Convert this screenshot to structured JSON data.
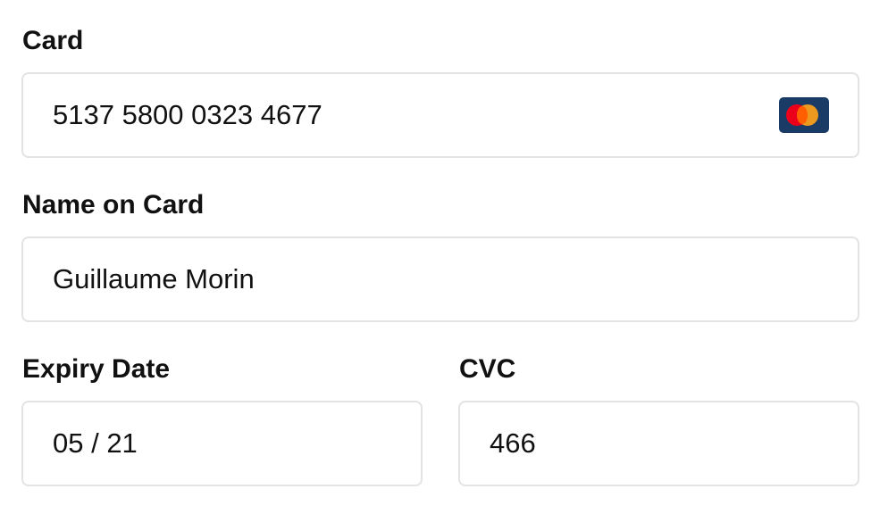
{
  "card": {
    "label": "Card",
    "number": "5137 5800 0323 4677",
    "brand_icon": "mastercard-icon",
    "brand_colors": {
      "left": "#eb001b",
      "right": "#f79e1b",
      "background": "#1a3b66"
    }
  },
  "name_on_card": {
    "label": "Name on Card",
    "value": "Guillaume Morin"
  },
  "expiry": {
    "label": "Expiry Date",
    "value": "05 / 21"
  },
  "cvc": {
    "label": "CVC",
    "value": "466"
  }
}
